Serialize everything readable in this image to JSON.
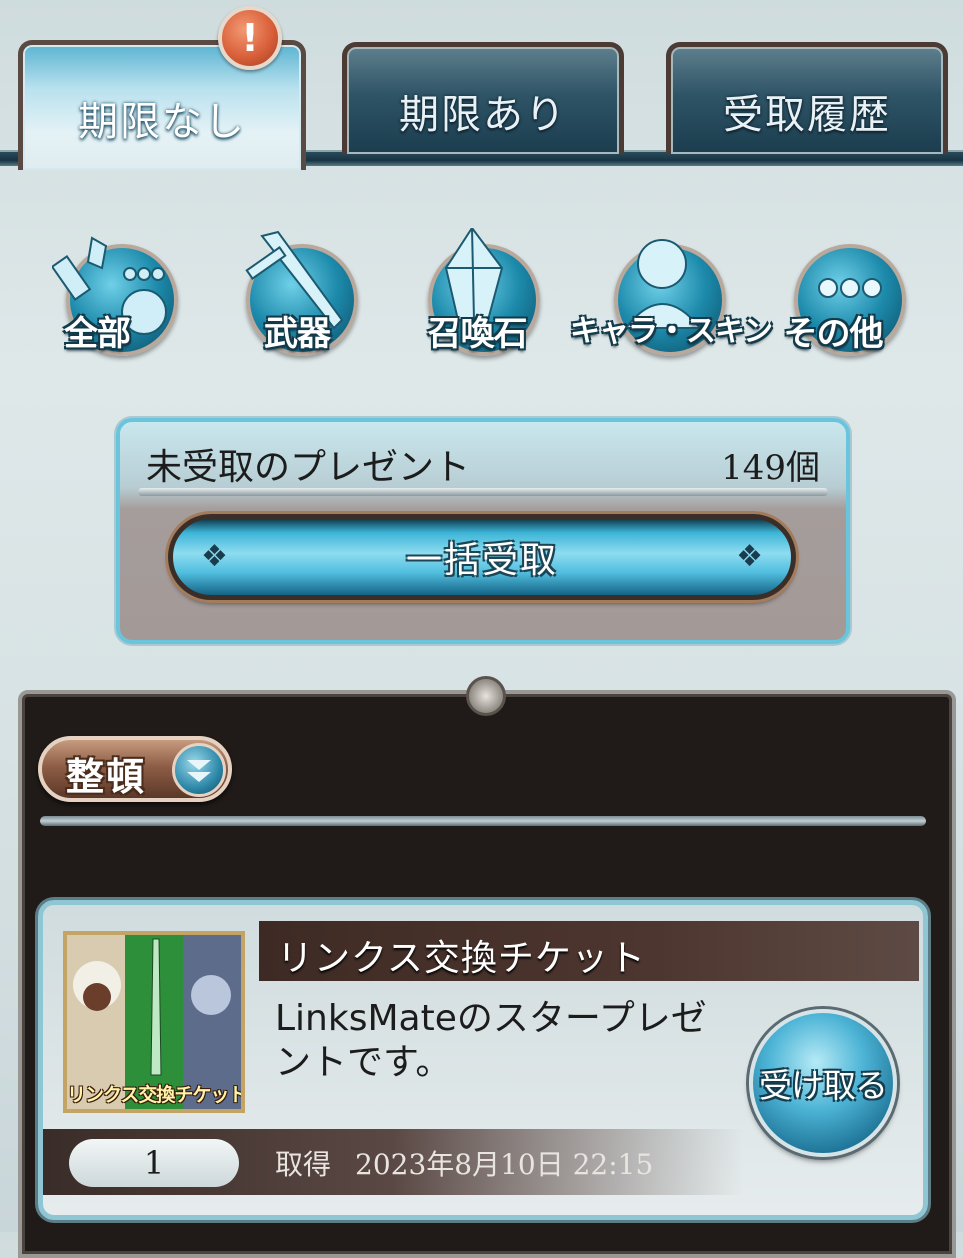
{
  "tabs": {
    "active": "期限なし",
    "items": [
      {
        "label": "期限なし"
      },
      {
        "label": "期限あり"
      },
      {
        "label": "受取履歴"
      }
    ],
    "badge": "!"
  },
  "categories": [
    {
      "label": "全部",
      "icon": "all-icon"
    },
    {
      "label": "武器",
      "icon": "sword-icon"
    },
    {
      "label": "召喚石",
      "icon": "crystal-icon"
    },
    {
      "label": "キャラ・スキン",
      "icon": "character-icon"
    },
    {
      "label": "その他",
      "icon": "more-icon"
    }
  ],
  "present": {
    "title": "未受取のプレゼント",
    "count": "149個",
    "bulk_button": "一括受取"
  },
  "list": {
    "sort_label": "整頓",
    "items": [
      {
        "name": "リンクス交換チケット",
        "thumb_label": "リンクス交換チケット",
        "description": "LinksMateのスタープレゼントです。",
        "quantity": "1",
        "obtain_label": "取得",
        "obtain_date": "2023年8月10日 22:15",
        "receive_button": "受け取る"
      }
    ]
  },
  "colors": {
    "accent": "#3db4d6",
    "badge": "#d9603a",
    "panel_dark": "#201b18"
  }
}
